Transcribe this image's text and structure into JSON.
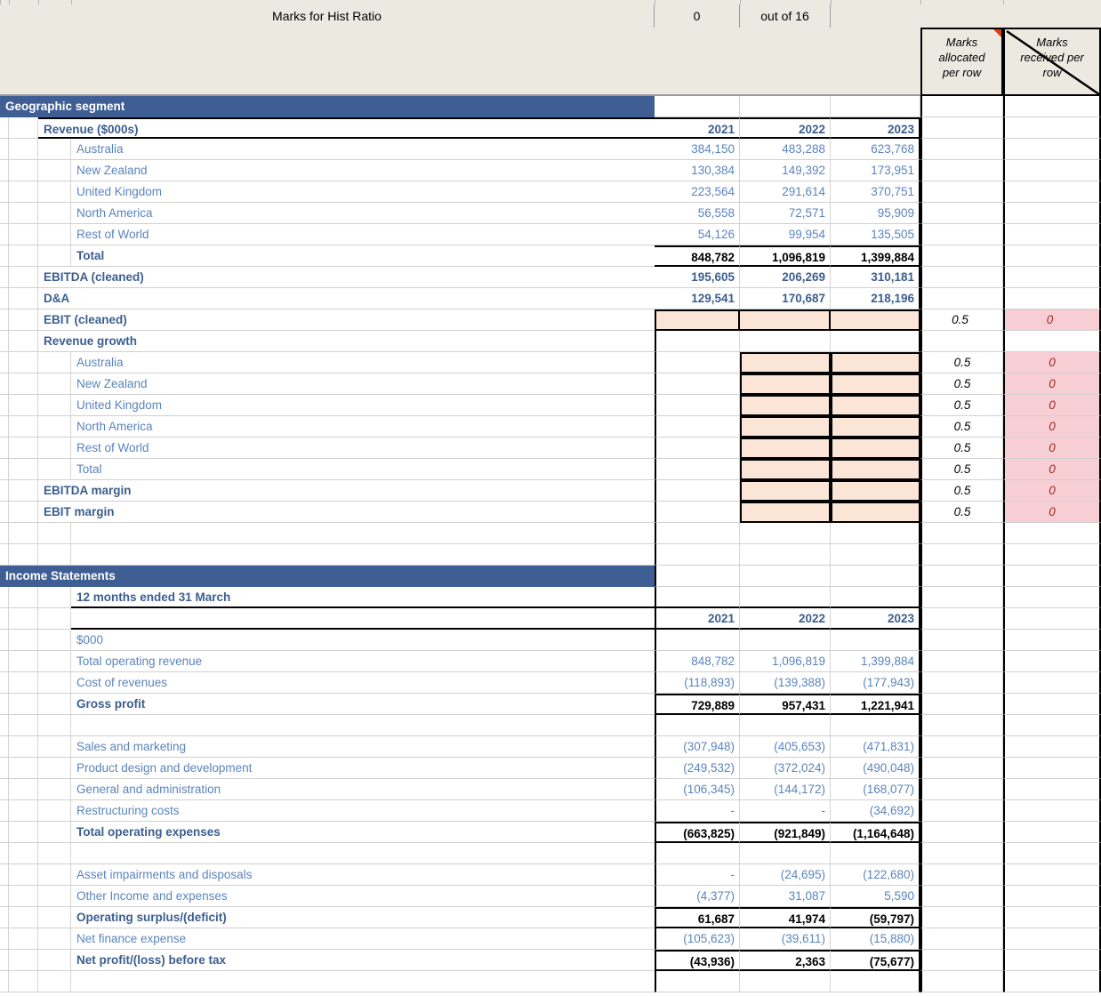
{
  "marks_header": {
    "title": "Marks for Hist Ratio",
    "score": "0",
    "out_of": "out of 16",
    "col_alloc_label": "Marks allocated per row",
    "col_recv_label": "Marks received per row",
    "alloc_line1": "Marks",
    "alloc_line2": "allocated",
    "alloc_line3": "per row",
    "recv_line1": "Marks",
    "recv_line2": "received per",
    "recv_line3": "row"
  },
  "colors": {
    "banner": "#3f5f94",
    "blue_text": "#5b84bd",
    "dark_blue_text": "#3c5e8f",
    "peach_fill": "#fbe5d6",
    "pink_fill": "#f8ced5",
    "red_text": "#9e2320",
    "header_fill": "#ece9e1"
  },
  "sections": {
    "geographic": {
      "banner": "Geographic segment",
      "revenue_title": "Revenue ($000s)",
      "years": [
        "2021",
        "2022",
        "2023"
      ],
      "rows": [
        {
          "label": "Australia",
          "v": [
            "384,150",
            "483,288",
            "623,768"
          ]
        },
        {
          "label": "New Zealand",
          "v": [
            "130,384",
            "149,392",
            "173,951"
          ]
        },
        {
          "label": "United Kingdom",
          "v": [
            "223,564",
            "291,614",
            "370,751"
          ]
        },
        {
          "label": "North America",
          "v": [
            "56,558",
            "72,571",
            "95,909"
          ]
        },
        {
          "label": "Rest of World",
          "v": [
            "54,126",
            "99,954",
            "135,505"
          ]
        },
        {
          "label": "Total",
          "v": [
            "848,782",
            "1,096,819",
            "1,399,884"
          ]
        }
      ],
      "ebitda_cleaned": {
        "label": "EBITDA (cleaned)",
        "v": [
          "195,605",
          "206,269",
          "310,181"
        ]
      },
      "da": {
        "label": "D&A",
        "v": [
          "129,541",
          "170,687",
          "218,196"
        ]
      },
      "ebit_cleaned": {
        "label": "EBIT (cleaned)",
        "v": [
          "",
          "",
          ""
        ],
        "alloc": "0.5",
        "recv": "0"
      },
      "growth_title": "Revenue growth",
      "growth_rows": [
        {
          "label": "Australia",
          "alloc": "0.5",
          "recv": "0"
        },
        {
          "label": "New Zealand",
          "alloc": "0.5",
          "recv": "0"
        },
        {
          "label": "United Kingdom",
          "alloc": "0.5",
          "recv": "0"
        },
        {
          "label": "North America",
          "alloc": "0.5",
          "recv": "0"
        },
        {
          "label": "Rest of World",
          "alloc": "0.5",
          "recv": "0"
        },
        {
          "label": "Total",
          "alloc": "0.5",
          "recv": "0"
        }
      ],
      "ebitda_margin": {
        "label": "EBITDA margin",
        "alloc": "0.5",
        "recv": "0"
      },
      "ebit_margin": {
        "label": "EBIT margin",
        "alloc": "0.5",
        "recv": "0"
      }
    },
    "income": {
      "banner": "Income Statements",
      "subtitle": "12 months ended 31 March",
      "years": [
        "2021",
        "2022",
        "2023"
      ],
      "unit": "$000",
      "rows": [
        {
          "label": "Total operating revenue",
          "v": [
            "848,782",
            "1,096,819",
            "1,399,884"
          ],
          "style": "blue"
        },
        {
          "label": "Cost of revenues",
          "v": [
            "(118,893)",
            "(139,388)",
            "(177,943)"
          ],
          "style": "blue"
        },
        {
          "label": "Gross profit",
          "v": [
            "729,889",
            "957,431",
            "1,221,941"
          ],
          "style": "totalplain"
        },
        {
          "label": "",
          "v": [
            "",
            "",
            ""
          ],
          "style": "blank"
        },
        {
          "label": "Sales and marketing",
          "v": [
            "(307,948)",
            "(405,653)",
            "(471,831)"
          ],
          "style": "blue"
        },
        {
          "label": "Product design and development",
          "v": [
            "(249,532)",
            "(372,024)",
            "(490,048)"
          ],
          "style": "blue"
        },
        {
          "label": "General and administration",
          "v": [
            "(106,345)",
            "(144,172)",
            "(168,077)"
          ],
          "style": "blue"
        },
        {
          "label": "Restructuring costs",
          "v": [
            "-",
            "-",
            "(34,692)"
          ],
          "style": "blue"
        },
        {
          "label": "Total operating expenses",
          "v": [
            "(663,825)",
            "(921,849)",
            "(1,164,648)"
          ],
          "style": "total"
        },
        {
          "label": "",
          "v": [
            "",
            "",
            ""
          ],
          "style": "blank"
        },
        {
          "label": "Asset impairments and disposals",
          "v": [
            "-",
            "(24,695)",
            "(122,680)"
          ],
          "style": "blue"
        },
        {
          "label": "Other Income and expenses",
          "v": [
            "(4,377)",
            "31,087",
            "5,590"
          ],
          "style": "blue"
        },
        {
          "label": "Operating surplus/(deficit)",
          "v": [
            "61,687",
            "41,974",
            "(59,797)"
          ],
          "style": "total"
        },
        {
          "label": "Net finance expense",
          "v": [
            "(105,623)",
            "(39,611)",
            "(15,880)"
          ],
          "style": "blue"
        },
        {
          "label": "Net profit/(loss) before tax",
          "v": [
            "(43,936)",
            "2,363",
            "(75,677)"
          ],
          "style": "total"
        }
      ]
    }
  }
}
